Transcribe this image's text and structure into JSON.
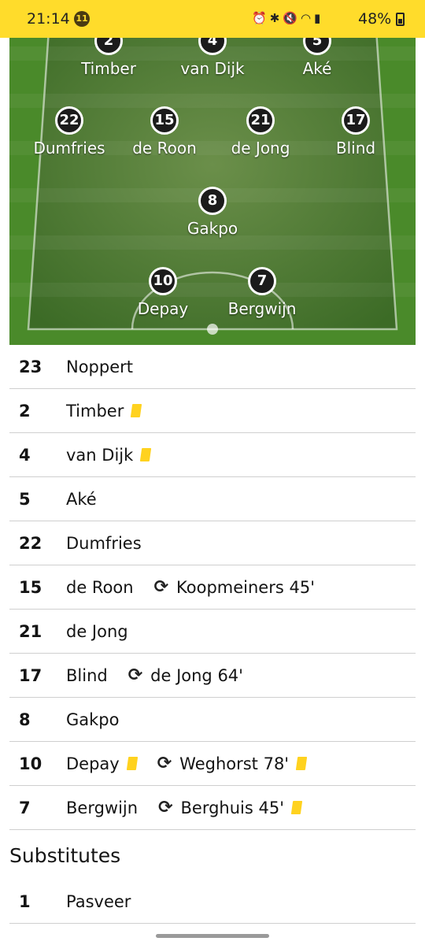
{
  "status_bar": {
    "time": "21:14",
    "notification_count": "11",
    "battery": "48%"
  },
  "pitch_players": [
    {
      "number": "2",
      "name": "Timber"
    },
    {
      "number": "4",
      "name": "van Dijk"
    },
    {
      "number": "5",
      "name": "Aké"
    },
    {
      "number": "22",
      "name": "Dumfries"
    },
    {
      "number": "15",
      "name": "de Roon"
    },
    {
      "number": "21",
      "name": "de Jong"
    },
    {
      "number": "17",
      "name": "Blind"
    },
    {
      "number": "8",
      "name": "Gakpo"
    },
    {
      "number": "10",
      "name": "Depay"
    },
    {
      "number": "7",
      "name": "Bergwijn"
    }
  ],
  "lineup": [
    {
      "number": "23",
      "name": "Noppert"
    },
    {
      "number": "2",
      "name": "Timber"
    },
    {
      "number": "4",
      "name": "van Dijk"
    },
    {
      "number": "5",
      "name": "Aké"
    },
    {
      "number": "22",
      "name": "Dumfries"
    },
    {
      "number": "15",
      "name": "de Roon",
      "sub": "Koopmeiners 45'"
    },
    {
      "number": "21",
      "name": "de Jong"
    },
    {
      "number": "17",
      "name": "Blind",
      "sub": "de Jong 64'"
    },
    {
      "number": "8",
      "name": "Gakpo"
    },
    {
      "number": "10",
      "name": "Depay",
      "sub": "Weghorst 78'"
    },
    {
      "number": "7",
      "name": "Bergwijn",
      "sub": "Berghuis 45'"
    }
  ],
  "substitutes_heading": "Substitutes",
  "substitutes": [
    {
      "number": "1",
      "name": "Pasveer"
    }
  ],
  "colors": {
    "status_bar": "#ffdc2b",
    "pitch": "#4a8a2a",
    "yellow_card": "#ffd21f"
  },
  "icons": {
    "substitution": "substitution-icon",
    "card": "yellow-card-icon"
  }
}
